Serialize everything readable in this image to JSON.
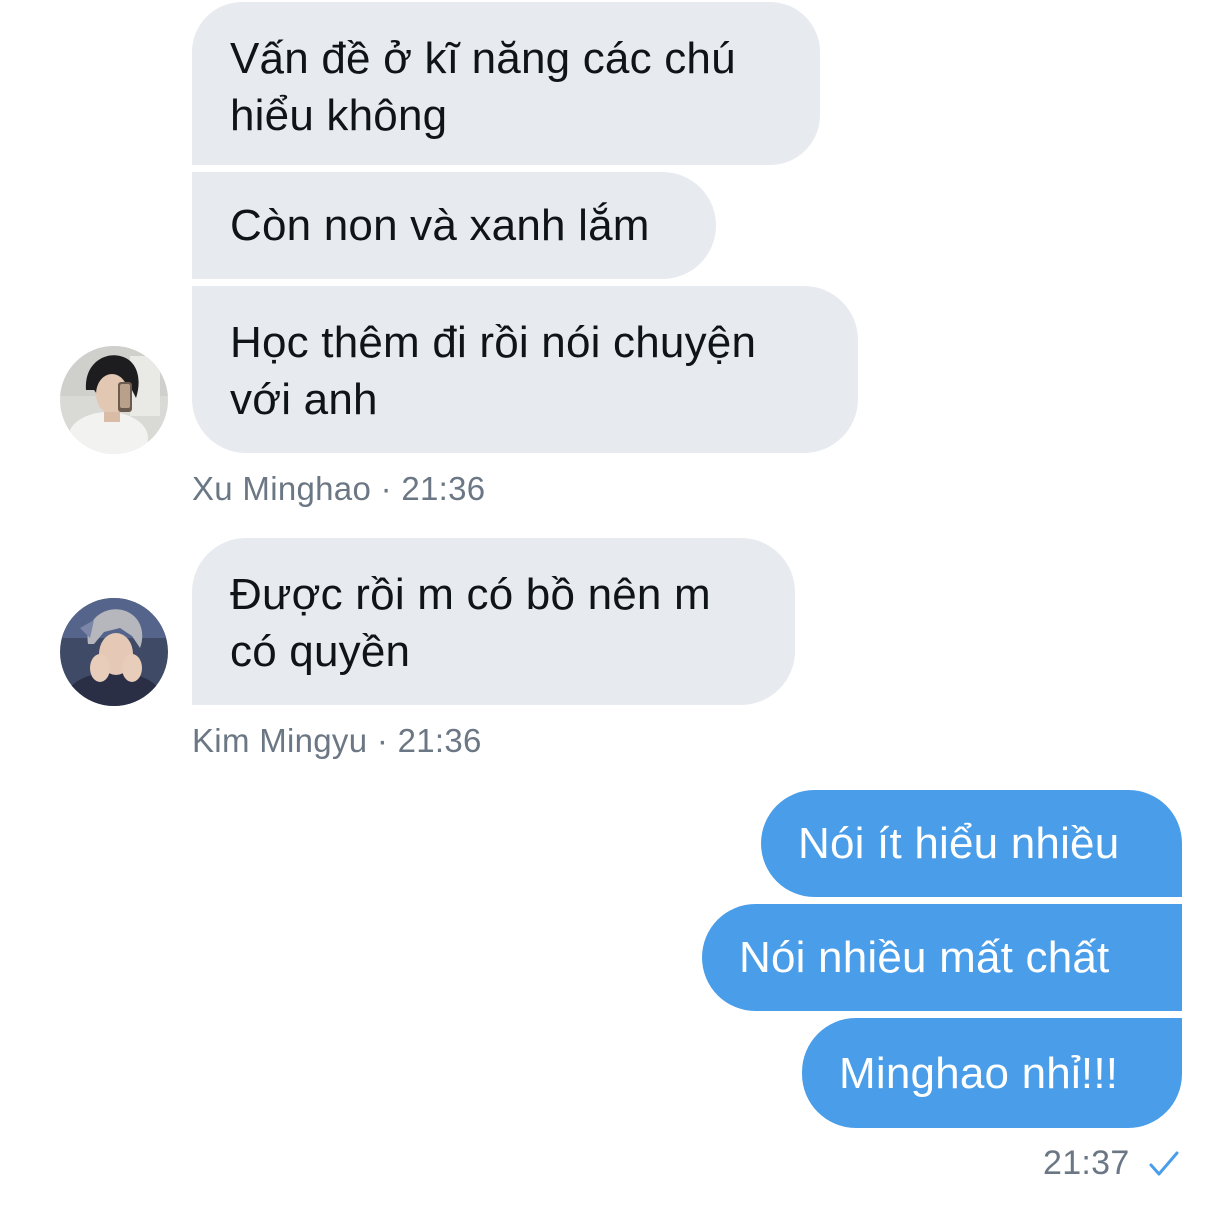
{
  "conversation": {
    "groups": [
      {
        "sender": "Xu Minghao",
        "time": "21:36",
        "avatar_icon": "user-avatar-photo",
        "messages": [
          {
            "lines": [
              "Vấn đề ở kĩ năng các chú",
              "hiểu không"
            ]
          },
          {
            "lines": [
              "Còn non và xanh lắm"
            ]
          },
          {
            "lines": [
              "Học thêm đi rồi nói chuyện",
              "với anh"
            ]
          }
        ]
      },
      {
        "sender": "Kim Mingyu",
        "time": "21:36",
        "avatar_icon": "user-avatar-photo",
        "messages": [
          {
            "lines": [
              "Được rồi m có bồ nên m",
              "có quyền"
            ]
          }
        ]
      }
    ],
    "outgoing": {
      "time": "21:37",
      "status_icon": "sent-check-icon",
      "messages": [
        {
          "lines": [
            "Nói ít hiểu nhiều"
          ]
        },
        {
          "lines": [
            "Nói nhiều mất chất"
          ]
        },
        {
          "lines": [
            "Minghao nhỉ!!!"
          ]
        }
      ]
    },
    "separator": "·"
  },
  "colors": {
    "received_bubble": "#e7eaef",
    "sent_bubble": "#4a9de8",
    "meta_text": "#6b7784",
    "check": "#4a9de8"
  }
}
